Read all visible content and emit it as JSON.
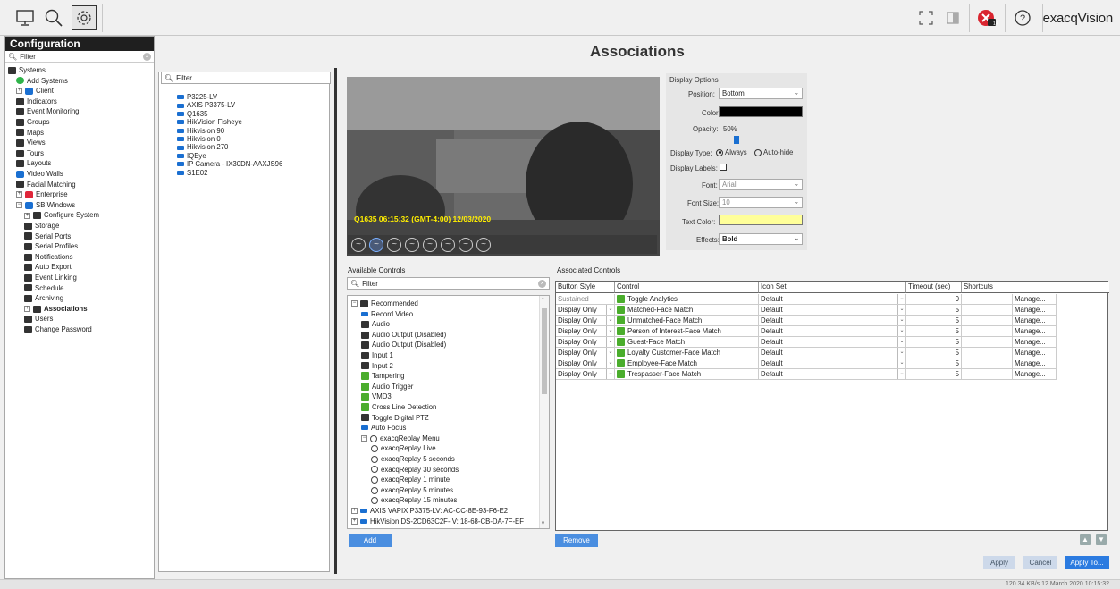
{
  "toolbar": {
    "brand": "exacqVision",
    "buttons": [
      "monitor-icon",
      "search-icon",
      "gear-icon"
    ],
    "right_icons": [
      "fullscreen-icon",
      "exit-icon",
      "notification-icon",
      "help-icon"
    ],
    "notification_badge": "14"
  },
  "left": {
    "title": "Configuration",
    "filter_placeholder": "Filter",
    "items": [
      {
        "label": "Systems",
        "icon": "systems-icon"
      },
      {
        "label": "Add Systems",
        "icon": "add-icon"
      },
      {
        "label": "Client",
        "icon": "client-icon"
      },
      {
        "label": "Indicators",
        "icon": "flag-icon"
      },
      {
        "label": "Event Monitoring",
        "icon": "link-icon"
      },
      {
        "label": "Groups",
        "icon": "groups-icon"
      },
      {
        "label": "Maps",
        "icon": "map-icon"
      },
      {
        "label": "Views",
        "icon": "views-icon"
      },
      {
        "label": "Tours",
        "icon": "tours-icon"
      },
      {
        "label": "Layouts",
        "icon": "layouts-icon"
      },
      {
        "label": "Video Walls",
        "icon": "videowall-icon"
      },
      {
        "label": "Facial Matching",
        "icon": "face-icon"
      },
      {
        "label": "Enterprise",
        "icon": "enterprise-icon"
      },
      {
        "label": "SB Windows",
        "icon": "server-icon"
      },
      {
        "label": "Configure System",
        "icon": "system-icon"
      },
      {
        "label": "Storage",
        "icon": "storage-icon"
      },
      {
        "label": "Serial Ports",
        "icon": "serial-icon"
      },
      {
        "label": "Serial Profiles",
        "icon": "profile-icon"
      },
      {
        "label": "Notifications",
        "icon": "notification-icon"
      },
      {
        "label": "Auto Export",
        "icon": "export-icon"
      },
      {
        "label": "Event Linking",
        "icon": "eventlink-icon"
      },
      {
        "label": "Schedule",
        "icon": "schedule-icon"
      },
      {
        "label": "Archiving",
        "icon": "archive-icon"
      },
      {
        "label": "Associations",
        "icon": "associations-icon"
      },
      {
        "label": "Users",
        "icon": "user-icon"
      },
      {
        "label": "Change Password",
        "icon": "password-icon"
      }
    ]
  },
  "devices": {
    "filter_placeholder": "Filter",
    "items": [
      "P3225-LV",
      "AXIS P3375-LV",
      "Q1635",
      "HikVision Fisheye",
      "Hikvision 90",
      "Hikvision 0",
      "Hikvision 270",
      "IQEye",
      "IP Camera - IX30DN-AAXJS96",
      "S1E02"
    ]
  },
  "page_title": "Associations",
  "camera": {
    "overlay": "Q1635 06:15:32 (GMT-4:00) 12/03/2020"
  },
  "display_options": {
    "title": "Display Options",
    "position_label": "Position:",
    "position_value": "Bottom",
    "color_label": "Color:",
    "color_value": "#000000",
    "opacity_label": "Opacity:",
    "opacity_value": "50%",
    "display_type_label": "Display Type:",
    "always": "Always",
    "autohide": "Auto-hide",
    "display_labels_label": "Display Labels:",
    "font_label": "Font:",
    "font_value": "Arial",
    "font_size_label": "Font Size:",
    "font_size_value": "10",
    "text_color_label": "Text Color:",
    "text_color_value": "#ffff99",
    "effects_label": "Effects:",
    "effects_value": "Bold"
  },
  "available": {
    "title": "Available Controls",
    "filter_placeholder": "Filter",
    "items": [
      {
        "label": "Recommended",
        "level": 0,
        "icon": "folder-icon"
      },
      {
        "label": "Record Video",
        "level": 1,
        "icon": "camera-icon"
      },
      {
        "label": "Audio",
        "level": 1,
        "icon": "speaker-icon"
      },
      {
        "label": "Audio Output (Disabled)",
        "level": 1,
        "icon": "speaker-icon"
      },
      {
        "label": "Audio Output (Disabled)",
        "level": 1,
        "icon": "microphone-icon"
      },
      {
        "label": "Input 1",
        "level": 1,
        "icon": "input-icon"
      },
      {
        "label": "Input 2",
        "level": 1,
        "icon": "input-icon"
      },
      {
        "label": "Tampering",
        "level": 1,
        "icon": "analytics-icon"
      },
      {
        "label": "Audio Trigger",
        "level": 1,
        "icon": "analytics-icon"
      },
      {
        "label": "VMD3",
        "level": 1,
        "icon": "analytics-icon"
      },
      {
        "label": "Cross Line Detection",
        "level": 1,
        "icon": "analytics-icon"
      },
      {
        "label": "Toggle Digital PTZ",
        "level": 1,
        "icon": "ptz-icon"
      },
      {
        "label": "Auto Focus",
        "level": 1,
        "icon": "camera-icon"
      },
      {
        "label": "exacqReplay Menu",
        "level": 1,
        "icon": "replay-icon"
      },
      {
        "label": "exacqReplay Live",
        "level": 2,
        "icon": "replay-icon"
      },
      {
        "label": "exacqReplay 5 seconds",
        "level": 2,
        "icon": "replay-icon"
      },
      {
        "label": "exacqReplay 30 seconds",
        "level": 2,
        "icon": "replay-icon"
      },
      {
        "label": "exacqReplay 1 minute",
        "level": 2,
        "icon": "replay-icon"
      },
      {
        "label": "exacqReplay 5 minutes",
        "level": 2,
        "icon": "replay-icon"
      },
      {
        "label": "exacqReplay 15 minutes",
        "level": 2,
        "icon": "replay-icon"
      },
      {
        "label": "AXIS VAPIX P3375-LV: AC-CC-8E-93-F6-E2",
        "level": 0,
        "icon": "camera-icon"
      },
      {
        "label": "HikVision DS-2CD63C2F-IV: 18-68-CB-DA-7F-EF",
        "level": 0,
        "icon": "camera-icon"
      }
    ],
    "add_label": "Add"
  },
  "associated": {
    "title": "Associated Controls",
    "headers": [
      "Button Style",
      "Control",
      "Icon Set",
      "Timeout (sec)",
      "Shortcuts"
    ],
    "rows": [
      {
        "style": "Sustained",
        "control": "Toggle Analytics",
        "icon_set": "Default",
        "timeout": "0",
        "manage": "Manage..."
      },
      {
        "style": "Display Only",
        "control": "Matched-Face Match",
        "icon_set": "Default",
        "timeout": "5",
        "manage": "Manage..."
      },
      {
        "style": "Display Only",
        "control": "Unmatched-Face Match",
        "icon_set": "Default",
        "timeout": "5",
        "manage": "Manage..."
      },
      {
        "style": "Display Only",
        "control": "Person of Interest-Face Match",
        "icon_set": "Default",
        "timeout": "5",
        "manage": "Manage..."
      },
      {
        "style": "Display Only",
        "control": "Guest-Face Match",
        "icon_set": "Default",
        "timeout": "5",
        "manage": "Manage..."
      },
      {
        "style": "Display Only",
        "control": "Loyalty Customer-Face Match",
        "icon_set": "Default",
        "timeout": "5",
        "manage": "Manage..."
      },
      {
        "style": "Display Only",
        "control": "Employee-Face Match",
        "icon_set": "Default",
        "timeout": "5",
        "manage": "Manage..."
      },
      {
        "style": "Display Only",
        "control": "Trespasser-Face Match",
        "icon_set": "Default",
        "timeout": "5",
        "manage": "Manage..."
      }
    ],
    "remove_label": "Remove"
  },
  "footer": {
    "apply": "Apply",
    "cancel": "Cancel",
    "apply_to": "Apply To..."
  },
  "status": {
    "text": "120.34 KB/s    12 March 2020    10:15:32"
  }
}
